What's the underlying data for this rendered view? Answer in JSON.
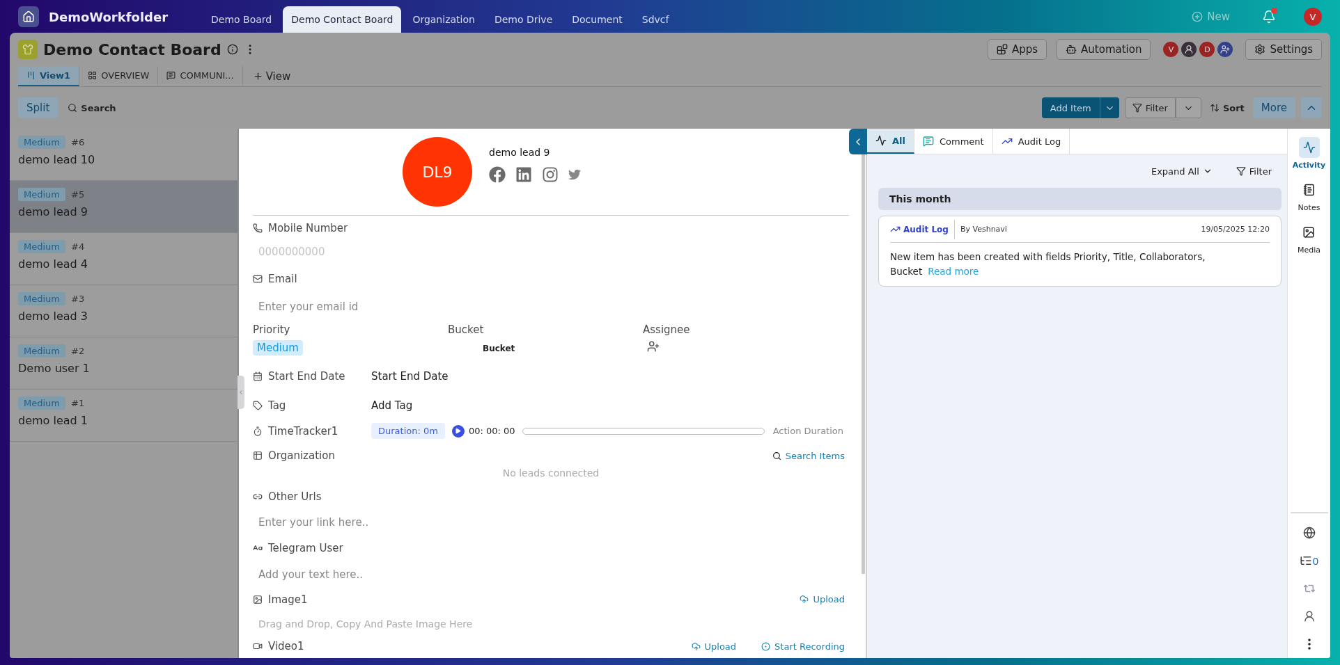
{
  "top_nav": {
    "workspace": "DemoWorkfolder",
    "tabs": [
      {
        "label": "Demo Board",
        "selected": false
      },
      {
        "label": "Demo Contact Board",
        "selected": true
      },
      {
        "label": "Organization",
        "selected": false
      },
      {
        "label": "Demo Drive",
        "selected": false
      },
      {
        "label": "Document",
        "selected": false
      },
      {
        "label": "Sdvcf",
        "selected": false
      }
    ],
    "new_label": "New",
    "notification_unread": true,
    "user_initial": "V"
  },
  "board": {
    "title": "Demo Contact Board",
    "views": [
      {
        "label": "View1",
        "kind": "kanban",
        "selected": true
      },
      {
        "label": "OVERVIEW",
        "kind": "grid",
        "selected": false
      },
      {
        "label": "COMMUNI...",
        "kind": "chat",
        "selected": false
      }
    ],
    "add_view": "View",
    "buttons": {
      "apps": "Apps",
      "automation": "Automation",
      "settings": "Settings"
    },
    "members": [
      {
        "kind": "initial",
        "initial": "V",
        "color": "#9c2323"
      },
      {
        "kind": "photo"
      },
      {
        "kind": "initial",
        "initial": "D",
        "color": "#9c2323"
      },
      {
        "kind": "add",
        "color": "#34408a"
      }
    ]
  },
  "toolbar": {
    "split": "Split",
    "search": "Search",
    "add_item": "Add Item",
    "filter": "Filter",
    "sort": "Sort",
    "more": "More"
  },
  "leads": [
    {
      "priority": "Medium",
      "number": "#6",
      "name": "demo lead 10",
      "selected": false
    },
    {
      "priority": "Medium",
      "number": "#5",
      "name": "demo lead 9",
      "selected": true
    },
    {
      "priority": "Medium",
      "number": "#4",
      "name": "demo lead 4",
      "selected": false
    },
    {
      "priority": "Medium",
      "number": "#3",
      "name": "demo lead 3",
      "selected": false
    },
    {
      "priority": "Medium",
      "number": "#2",
      "name": "Demo user 1",
      "selected": false
    },
    {
      "priority": "Medium",
      "number": "#1",
      "name": "demo lead 1",
      "selected": false
    }
  ],
  "detail": {
    "initials": "DL9",
    "name": "demo lead 9",
    "mobile": {
      "label": "Mobile Number",
      "placeholder": "0000000000"
    },
    "email": {
      "label": "Email",
      "placeholder": "Enter your email id"
    },
    "priority": {
      "label": "Priority",
      "value": "Medium"
    },
    "bucket": {
      "label": "Bucket",
      "value": "Bucket"
    },
    "assignee": {
      "label": "Assignee"
    },
    "dates": {
      "label": "Start End Date",
      "value": "Start End Date"
    },
    "tag": {
      "label": "Tag",
      "value": "Add Tag"
    },
    "timer": {
      "label": "TimeTracker1",
      "duration": "Duration: 0m",
      "time": "00: 00: 00",
      "level": 0,
      "action": "Action Duration"
    },
    "organization": {
      "label": "Organization",
      "action": "Search Items",
      "empty": "No leads connected"
    },
    "urls": {
      "label": "Other Urls",
      "placeholder": "Enter your link here.."
    },
    "telegram": {
      "label": "Telegram User",
      "placeholder": "Add your text here.."
    },
    "image": {
      "label": "Image1",
      "action": "Upload",
      "hint": "Drag and Drop, Copy And Paste Image Here"
    },
    "video": {
      "label": "Video1",
      "upload": "Upload",
      "record": "Start Recording"
    }
  },
  "activity": {
    "tabs": [
      {
        "label": "All",
        "kind": "all",
        "selected": true
      },
      {
        "label": "Comment",
        "kind": "comment",
        "selected": false
      },
      {
        "label": "Audit Log",
        "kind": "audit",
        "selected": false
      }
    ],
    "expand_all": "Expand All",
    "filter": "Filter",
    "group": "This month",
    "entries": [
      {
        "type": "Audit Log",
        "author": "By Veshnavi",
        "time": "19/05/2025 12:20",
        "text": "New item has been created with fields Priority, Title, Collaborators, Bucket",
        "link": "Read more"
      }
    ]
  },
  "rail": {
    "items": [
      {
        "label": "Activity",
        "kind": "activity",
        "selected": true
      },
      {
        "label": "Notes",
        "kind": "notes",
        "selected": false
      },
      {
        "label": "Media",
        "kind": "media",
        "selected": false
      }
    ],
    "tools": [
      {
        "kind": "globe"
      },
      {
        "kind": "tree",
        "count": "0"
      },
      {
        "kind": "sync"
      },
      {
        "kind": "user"
      },
      {
        "kind": "more"
      }
    ]
  }
}
